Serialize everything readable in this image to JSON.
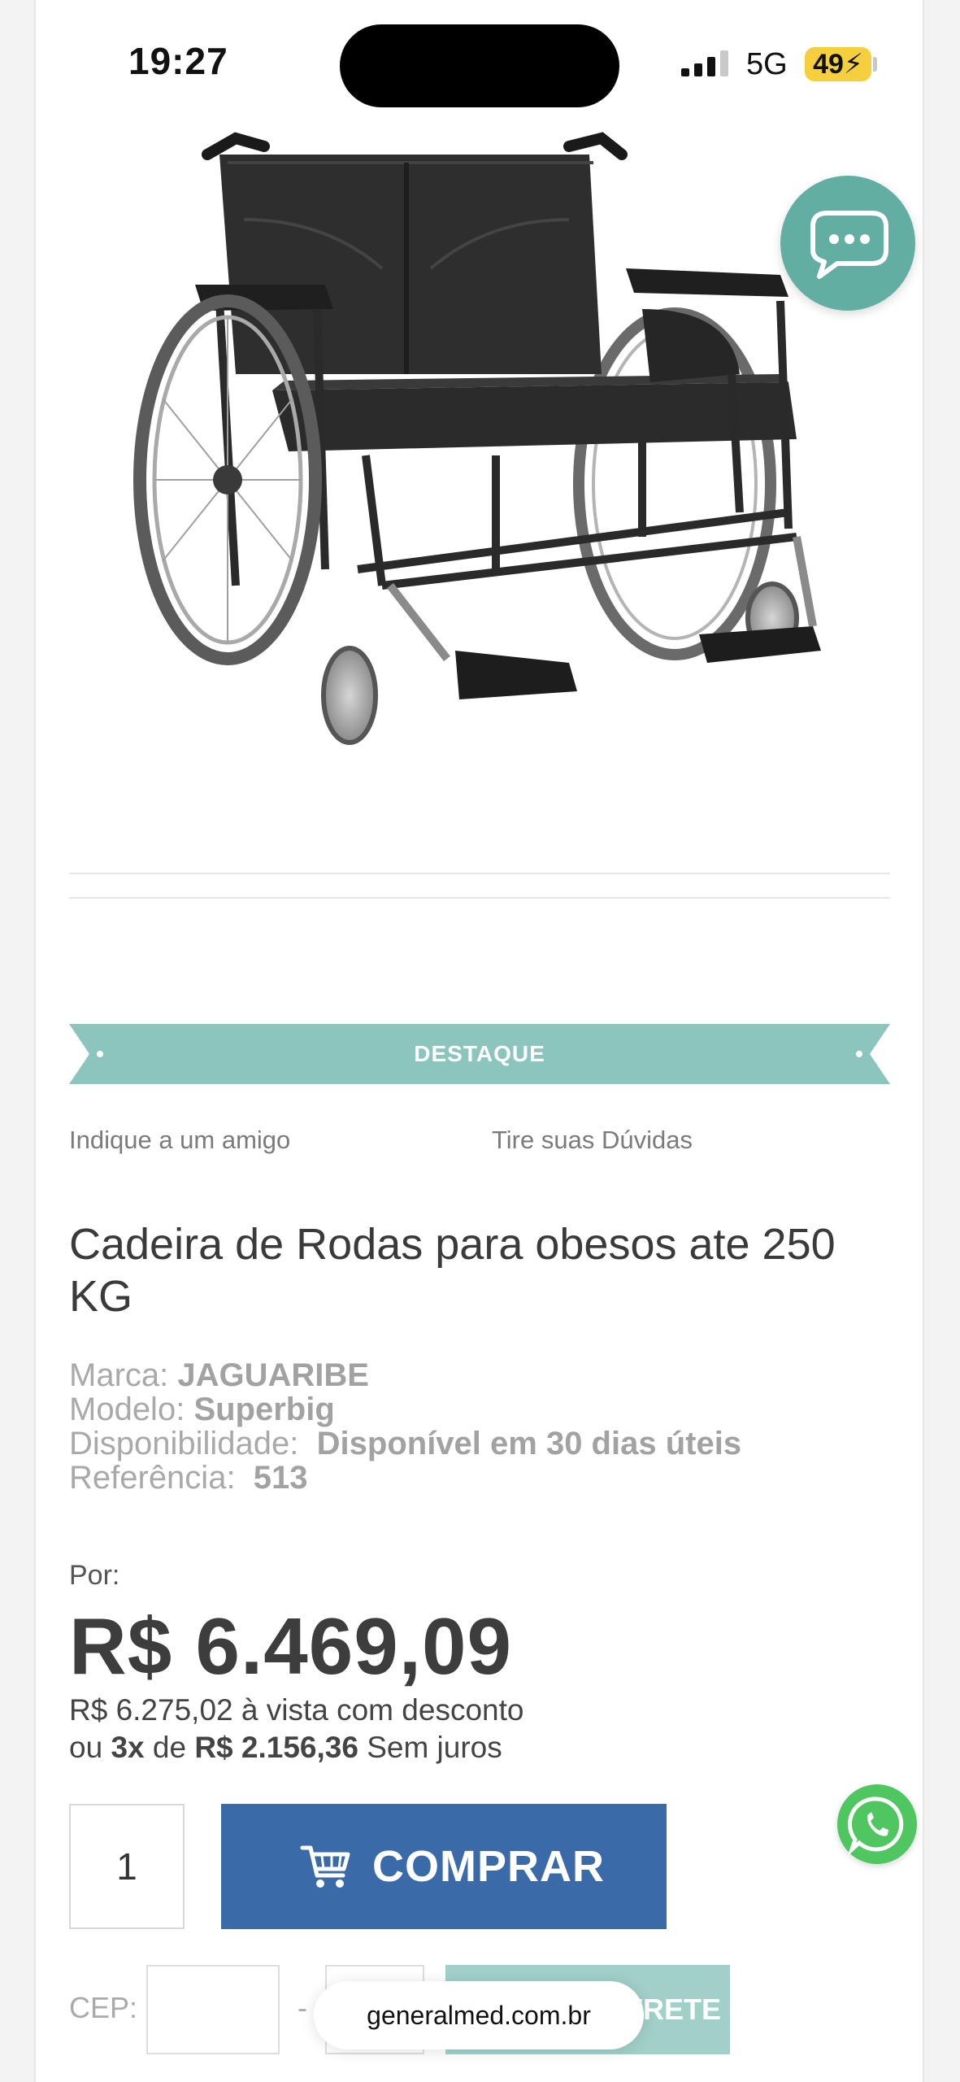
{
  "status_bar": {
    "time": "19:27",
    "network": "5G",
    "battery": "49"
  },
  "banner": {
    "label": "DESTAQUE"
  },
  "links": {
    "recommend": "Indique a um amigo",
    "questions": "Tire suas Dúvidas"
  },
  "product": {
    "title": "Cadeira de Rodas para obesos ate 250 KG",
    "specs": [
      {
        "label": "Marca:",
        "value": "JAGUARIBE"
      },
      {
        "label": "Modelo:",
        "value": "Superbig"
      },
      {
        "label": "Disponibilidade:",
        "value": "Disponível em 30 dias úteis"
      },
      {
        "label": "Referência:",
        "value": "513"
      }
    ]
  },
  "price": {
    "por_label": "Por:",
    "value": "R$ 6.469,09",
    "cash_value": "R$ 6.275,02",
    "cash_text": "à vista com desconto",
    "inst_prefix": "ou",
    "inst_count": "3x",
    "inst_of": "de",
    "inst_value": "R$ 2.156,36",
    "inst_suffix": "Sem juros"
  },
  "purchase": {
    "quantity": "1",
    "buy_label": "COMPRAR"
  },
  "shipping": {
    "cep_label": "CEP:",
    "dash": "-",
    "button_label": "CALCULAR FRETE"
  },
  "browser": {
    "url": "generalmed.com.br"
  },
  "colors": {
    "teal": "#8cc5be",
    "button_blue": "#3b6aa9",
    "whatsapp": "#50c660",
    "chat": "#63aea3"
  },
  "icons": [
    "chat-icon",
    "cart-icon",
    "whatsapp-icon",
    "signal-icon",
    "battery-icon"
  ]
}
